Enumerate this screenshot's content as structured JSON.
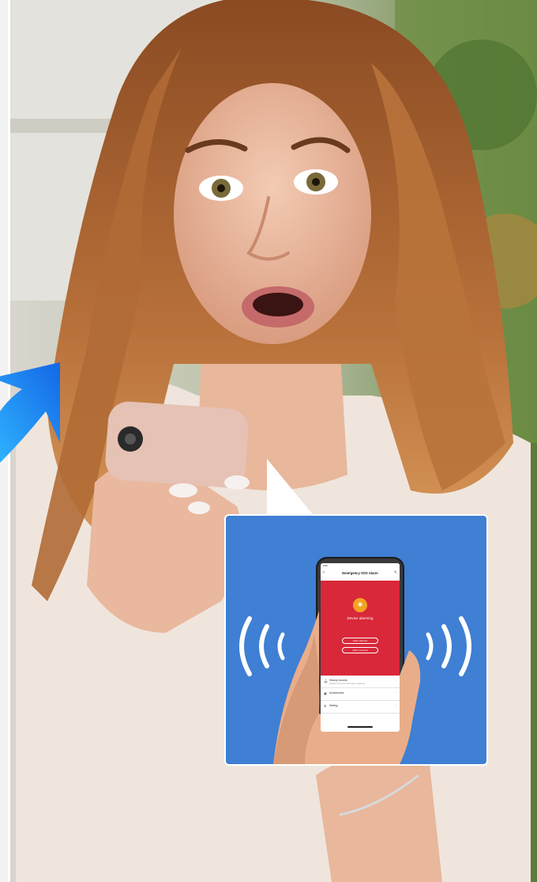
{
  "app": {
    "time": "9:02",
    "back_icon": "back-arrow-icon",
    "title": "Emergency SOS Alarm",
    "edit_icon": "edit-pencil-icon",
    "status_text": "Device alarming",
    "alarm_icon": "alarm-icon",
    "buttons": [
      "Alarm silenced",
      "Alarm removed"
    ],
    "list": [
      {
        "icon": "bell-icon",
        "label": "History records",
        "sub": "2023-04-19 10:24 SOS alarm triggered"
      },
      {
        "icon": "accessory-icon",
        "label": "Accessories",
        "sub": ""
      },
      {
        "icon": "gear-icon",
        "label": "Setting",
        "sub": ""
      }
    ]
  },
  "colors": {
    "inset_background": "#3f7fd4",
    "app_alarm_red": "#d8283a",
    "alarm_orange": "#f3a321",
    "arrow_blue": "#1a8cf2"
  }
}
